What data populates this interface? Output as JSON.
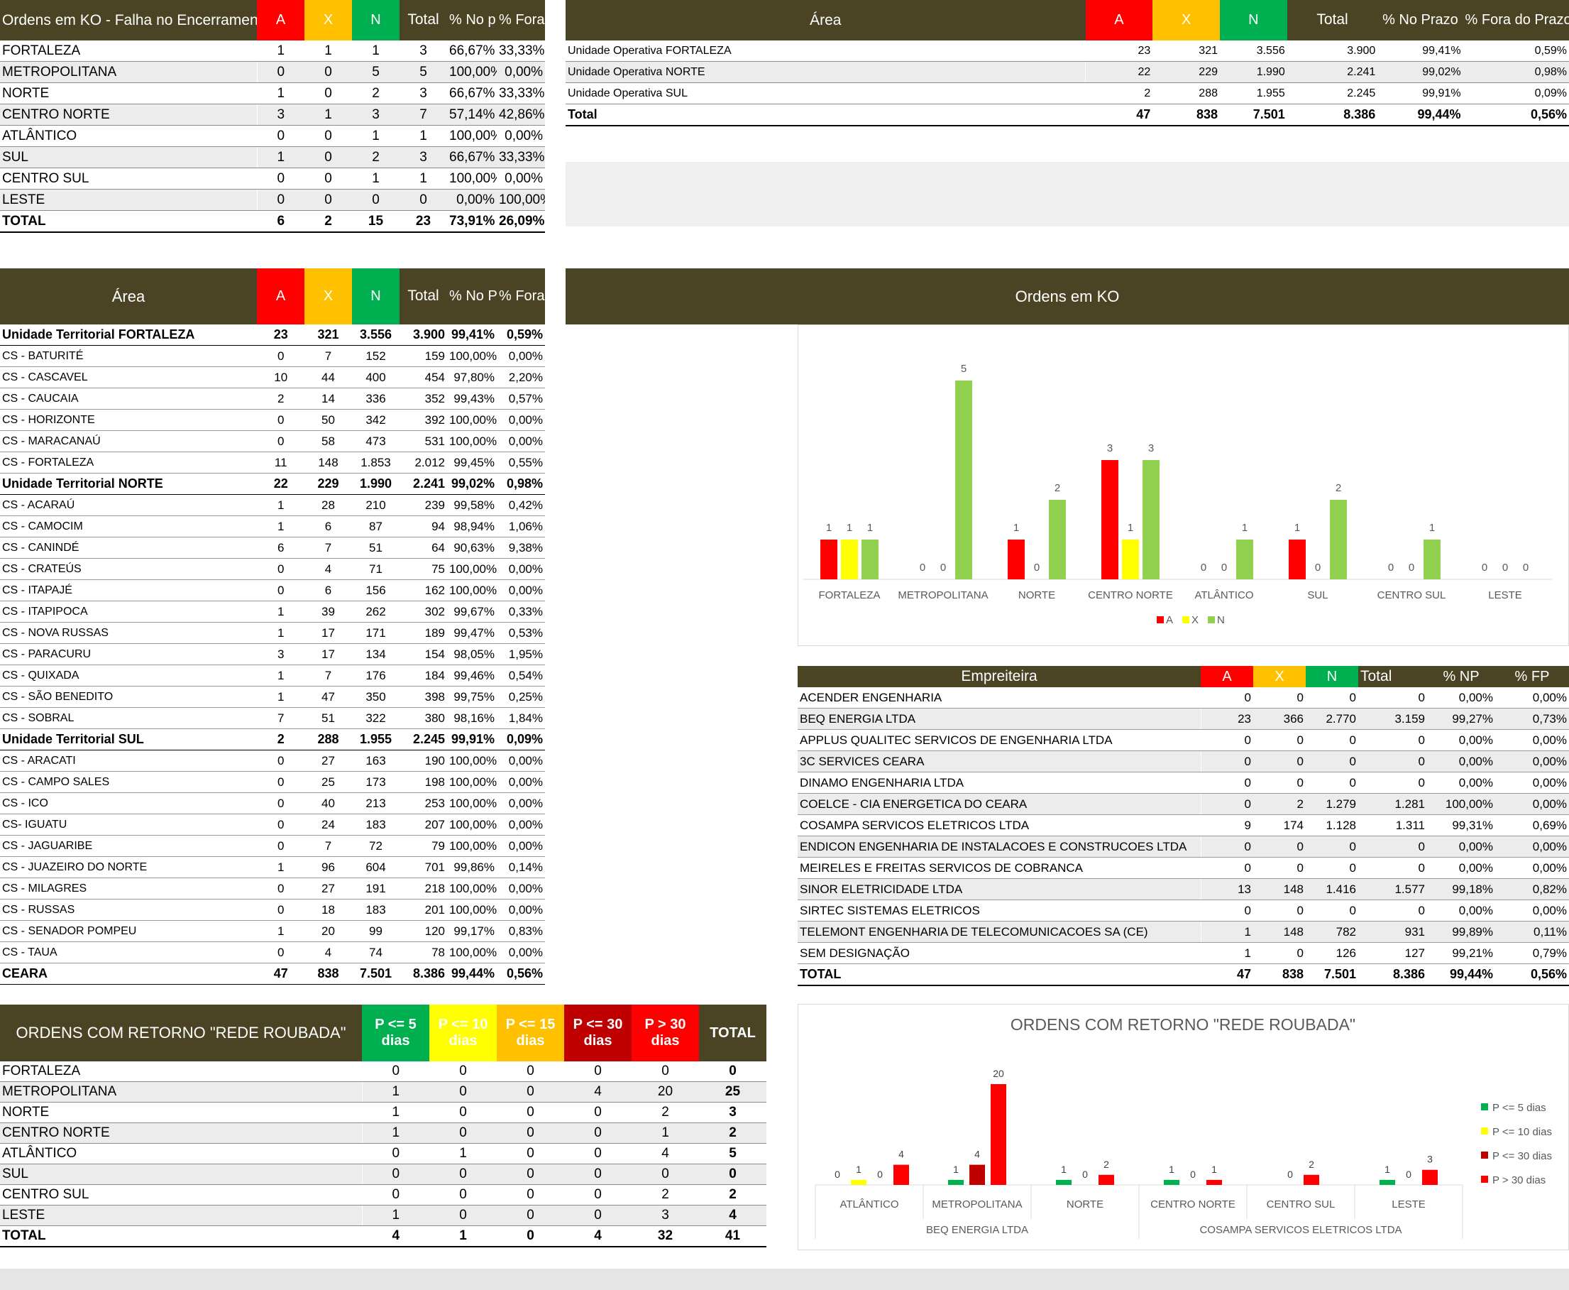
{
  "table_ko_regioes": {
    "title": "Ordens em KO - Falha no Encerramento",
    "headers": [
      "A",
      "X",
      "N",
      "Total",
      "% No prazo",
      "% Fora do Prazo"
    ],
    "rows": [
      [
        "FORTALEZA",
        "1",
        "1",
        "1",
        "3",
        "66,67%",
        "33,33%"
      ],
      [
        "METROPOLITANA",
        "0",
        "0",
        "5",
        "5",
        "100,00%",
        "0,00%"
      ],
      [
        "NORTE",
        "1",
        "0",
        "2",
        "3",
        "66,67%",
        "33,33%"
      ],
      [
        "CENTRO NORTE",
        "3",
        "1",
        "3",
        "7",
        "57,14%",
        "42,86%"
      ],
      [
        "ATLÂNTICO",
        "0",
        "0",
        "1",
        "1",
        "100,00%",
        "0,00%"
      ],
      [
        "SUL",
        "1",
        "0",
        "2",
        "3",
        "66,67%",
        "33,33%"
      ],
      [
        "CENTRO SUL",
        "0",
        "0",
        "1",
        "1",
        "100,00%",
        "0,00%"
      ],
      [
        "LESTE",
        "0",
        "0",
        "0",
        "0",
        "0,00%",
        "100,00%"
      ],
      [
        "TOTAL",
        "6",
        "2",
        "15",
        "23",
        "73,91%",
        "26,09%"
      ]
    ]
  },
  "table_area_unidades": {
    "headers": [
      "Área",
      "A",
      "X",
      "N",
      "Total",
      "% No Prazo",
      "% Fora do Prazo"
    ],
    "rows": [
      [
        "Unidade Operativa FORTALEZA",
        "23",
        "321",
        "3.556",
        "3.900",
        "99,41%",
        "0,59%"
      ],
      [
        "Unidade Operativa NORTE",
        "22",
        "229",
        "1.990",
        "2.241",
        "99,02%",
        "0,98%"
      ],
      [
        "Unidade Operativa SUL",
        "2",
        "288",
        "1.955",
        "2.245",
        "99,91%",
        "0,09%"
      ],
      [
        "Total",
        "47",
        "838",
        "7.501",
        "8.386",
        "99,44%",
        "0,56%"
      ]
    ]
  },
  "table_area_cs": {
    "headers": [
      "Área",
      "A",
      "X",
      "N",
      "Total",
      "% No Prazo",
      "% Fora do Prazo"
    ],
    "rows": [
      [
        "Unidade Territorial FORTALEZA",
        "23",
        "321",
        "3.556",
        "3.900",
        "99,41%",
        "0,59%"
      ],
      [
        "CS - BATURITÉ",
        "0",
        "7",
        "152",
        "159",
        "100,00%",
        "0,00%"
      ],
      [
        "CS - CASCAVEL",
        "10",
        "44",
        "400",
        "454",
        "97,80%",
        "2,20%"
      ],
      [
        "CS - CAUCAIA",
        "2",
        "14",
        "336",
        "352",
        "99,43%",
        "0,57%"
      ],
      [
        "CS - HORIZONTE",
        "0",
        "50",
        "342",
        "392",
        "100,00%",
        "0,00%"
      ],
      [
        "CS - MARACANAÚ",
        "0",
        "58",
        "473",
        "531",
        "100,00%",
        "0,00%"
      ],
      [
        "CS - FORTALEZA",
        "11",
        "148",
        "1.853",
        "2.012",
        "99,45%",
        "0,55%"
      ],
      [
        "Unidade Territorial NORTE",
        "22",
        "229",
        "1.990",
        "2.241",
        "99,02%",
        "0,98%"
      ],
      [
        "CS - ACARAÚ",
        "1",
        "28",
        "210",
        "239",
        "99,58%",
        "0,42%"
      ],
      [
        "CS - CAMOCIM",
        "1",
        "6",
        "87",
        "94",
        "98,94%",
        "1,06%"
      ],
      [
        "CS - CANINDÉ",
        "6",
        "7",
        "51",
        "64",
        "90,63%",
        "9,38%"
      ],
      [
        "CS - CRATEÚS",
        "0",
        "4",
        "71",
        "75",
        "100,00%",
        "0,00%"
      ],
      [
        "CS - ITAPAJÉ",
        "0",
        "6",
        "156",
        "162",
        "100,00%",
        "0,00%"
      ],
      [
        "CS - ITAPIPOCA",
        "1",
        "39",
        "262",
        "302",
        "99,67%",
        "0,33%"
      ],
      [
        "CS - NOVA RUSSAS",
        "1",
        "17",
        "171",
        "189",
        "99,47%",
        "0,53%"
      ],
      [
        "CS - PARACURU",
        "3",
        "17",
        "134",
        "154",
        "98,05%",
        "1,95%"
      ],
      [
        "CS - QUIXADA",
        "1",
        "7",
        "176",
        "184",
        "99,46%",
        "0,54%"
      ],
      [
        "CS - SÃO BENEDITO",
        "1",
        "47",
        "350",
        "398",
        "99,75%",
        "0,25%"
      ],
      [
        "CS - SOBRAL",
        "7",
        "51",
        "322",
        "380",
        "98,16%",
        "1,84%"
      ],
      [
        "Unidade Territorial SUL",
        "2",
        "288",
        "1.955",
        "2.245",
        "99,91%",
        "0,09%"
      ],
      [
        "CS - ARACATI",
        "0",
        "27",
        "163",
        "190",
        "100,00%",
        "0,00%"
      ],
      [
        "CS - CAMPO SALES",
        "0",
        "25",
        "173",
        "198",
        "100,00%",
        "0,00%"
      ],
      [
        "CS - ICO",
        "0",
        "40",
        "213",
        "253",
        "100,00%",
        "0,00%"
      ],
      [
        "CS- IGUATU",
        "0",
        "24",
        "183",
        "207",
        "100,00%",
        "0,00%"
      ],
      [
        "CS - JAGUARIBE",
        "0",
        "7",
        "72",
        "79",
        "100,00%",
        "0,00%"
      ],
      [
        "CS - JUAZEIRO DO NORTE",
        "1",
        "96",
        "604",
        "701",
        "99,86%",
        "0,14%"
      ],
      [
        "CS - MILAGRES",
        "0",
        "27",
        "191",
        "218",
        "100,00%",
        "0,00%"
      ],
      [
        "CS - RUSSAS",
        "0",
        "18",
        "183",
        "201",
        "100,00%",
        "0,00%"
      ],
      [
        "CS - SENADOR POMPEU",
        "1",
        "20",
        "99",
        "120",
        "99,17%",
        "0,83%"
      ],
      [
        "CS - TAUA",
        "0",
        "4",
        "74",
        "78",
        "100,00%",
        "0,00%"
      ],
      [
        "CEARA",
        "47",
        "838",
        "7.501",
        "8.386",
        "99,44%",
        "0,56%"
      ]
    ]
  },
  "table_empreiteira": {
    "headers": [
      "Empreiteira",
      "A",
      "X",
      "N",
      "Total",
      "% NP",
      "% FP"
    ],
    "rows": [
      [
        "ACENDER ENGENHARIA",
        "0",
        "0",
        "0",
        "0",
        "0,00%",
        "0,00%"
      ],
      [
        "BEQ ENERGIA LTDA",
        "23",
        "366",
        "2.770",
        "3.159",
        "99,27%",
        "0,73%"
      ],
      [
        "APPLUS QUALITEC SERVICOS DE ENGENHARIA LTDA",
        "0",
        "0",
        "0",
        "0",
        "0,00%",
        "0,00%"
      ],
      [
        "3C SERVICES CEARA",
        "0",
        "0",
        "0",
        "0",
        "0,00%",
        "0,00%"
      ],
      [
        "DINAMO ENGENHARIA LTDA",
        "0",
        "0",
        "0",
        "0",
        "0,00%",
        "0,00%"
      ],
      [
        "COELCE - CIA ENERGETICA DO CEARA",
        "0",
        "2",
        "1.279",
        "1.281",
        "100,00%",
        "0,00%"
      ],
      [
        "COSAMPA SERVICOS ELETRICOS LTDA",
        "9",
        "174",
        "1.128",
        "1.311",
        "99,31%",
        "0,69%"
      ],
      [
        "ENDICON ENGENHARIA DE INSTALACOES E CONSTRUCOES LTDA",
        "0",
        "0",
        "0",
        "0",
        "0,00%",
        "0,00%"
      ],
      [
        "MEIRELES E FREITAS SERVICOS DE COBRANCA",
        "0",
        "0",
        "0",
        "0",
        "0,00%",
        "0,00%"
      ],
      [
        "SINOR ELETRICIDADE LTDA",
        "13",
        "148",
        "1.416",
        "1.577",
        "99,18%",
        "0,82%"
      ],
      [
        "SIRTEC SISTEMAS ELETRICOS",
        "0",
        "0",
        "0",
        "0",
        "0,00%",
        "0,00%"
      ],
      [
        "TELEMONT ENGENHARIA DE TELECOMUNICACOES SA (CE)",
        "1",
        "148",
        "782",
        "931",
        "99,89%",
        "0,11%"
      ],
      [
        "SEM DESIGNAÇÃO",
        "1",
        "0",
        "126",
        "127",
        "99,21%",
        "0,79%"
      ],
      [
        "TOTAL",
        "47",
        "838",
        "7.501",
        "8.386",
        "99,44%",
        "0,56%"
      ]
    ]
  },
  "table_rede_roubada": {
    "title": "ORDENS COM RETORNO \"REDE ROUBADA\"",
    "headers": [
      "P <= 5 dias",
      "P <= 10 dias",
      "P <= 15 dias",
      "P <= 30 dias",
      "P > 30 dias",
      "TOTAL"
    ],
    "rows": [
      [
        "FORTALEZA",
        "0",
        "0",
        "0",
        "0",
        "0",
        "0"
      ],
      [
        "METROPOLITANA",
        "1",
        "0",
        "0",
        "4",
        "20",
        "25"
      ],
      [
        "NORTE",
        "1",
        "0",
        "0",
        "0",
        "2",
        "3"
      ],
      [
        "CENTRO NORTE",
        "1",
        "0",
        "0",
        "0",
        "1",
        "2"
      ],
      [
        "ATLÂNTICO",
        "0",
        "1",
        "0",
        "0",
        "4",
        "5"
      ],
      [
        "SUL",
        "0",
        "0",
        "0",
        "0",
        "0",
        "0"
      ],
      [
        "CENTRO SUL",
        "0",
        "0",
        "0",
        "0",
        "2",
        "2"
      ],
      [
        "LESTE",
        "1",
        "0",
        "0",
        "0",
        "3",
        "4"
      ],
      [
        "TOTAL",
        "4",
        "1",
        "0",
        "4",
        "32",
        "41"
      ]
    ]
  },
  "chart_data": [
    {
      "type": "bar",
      "title": "Ordens em KO",
      "categories": [
        "FORTALEZA",
        "METROPOLITANA",
        "NORTE",
        "CENTRO NORTE",
        "ATLÂNTICO",
        "SUL",
        "CENTRO SUL",
        "LESTE"
      ],
      "series": [
        {
          "name": "A",
          "color": "#ff0000",
          "values": [
            1,
            0,
            1,
            3,
            0,
            1,
            0,
            0
          ]
        },
        {
          "name": "X",
          "color": "#ffff00",
          "values": [
            1,
            0,
            0,
            1,
            0,
            0,
            0,
            0
          ]
        },
        {
          "name": "N",
          "color": "#92d050",
          "values": [
            1,
            5,
            2,
            3,
            1,
            2,
            1,
            0
          ]
        }
      ],
      "legend": "bottom"
    },
    {
      "type": "bar",
      "title": "ORDENS COM RETORNO \"REDE ROUBADA\"",
      "groups": [
        {
          "name": "BEQ ENERGIA LTDA",
          "categories": [
            "ATLÂNTICO",
            "METROPOLITANA",
            "NORTE"
          ]
        },
        {
          "name": "COSAMPA SERVICOS ELETRICOS LTDA",
          "categories": [
            "CENTRO NORTE",
            "CENTRO SUL",
            "LESTE"
          ]
        }
      ],
      "categories": [
        "ATLÂNTICO",
        "METROPOLITANA",
        "NORTE",
        "CENTRO NORTE",
        "CENTRO SUL",
        "LESTE"
      ],
      "series": [
        {
          "name": "P <= 5 dias",
          "color": "#00b050",
          "values": [
            0,
            1,
            1,
            1,
            null,
            1
          ]
        },
        {
          "name": "P <= 10 dias",
          "color": "#ffff00",
          "values": [
            1,
            null,
            null,
            null,
            null,
            null
          ]
        },
        {
          "name": "P <= 30 dias",
          "color": "#c00000",
          "values": [
            0,
            4,
            0,
            0,
            0,
            0
          ]
        },
        {
          "name": "P > 30 dias",
          "color": "#ff0000",
          "values": [
            4,
            20,
            2,
            1,
            2,
            3
          ]
        }
      ],
      "legend": "right"
    }
  ]
}
